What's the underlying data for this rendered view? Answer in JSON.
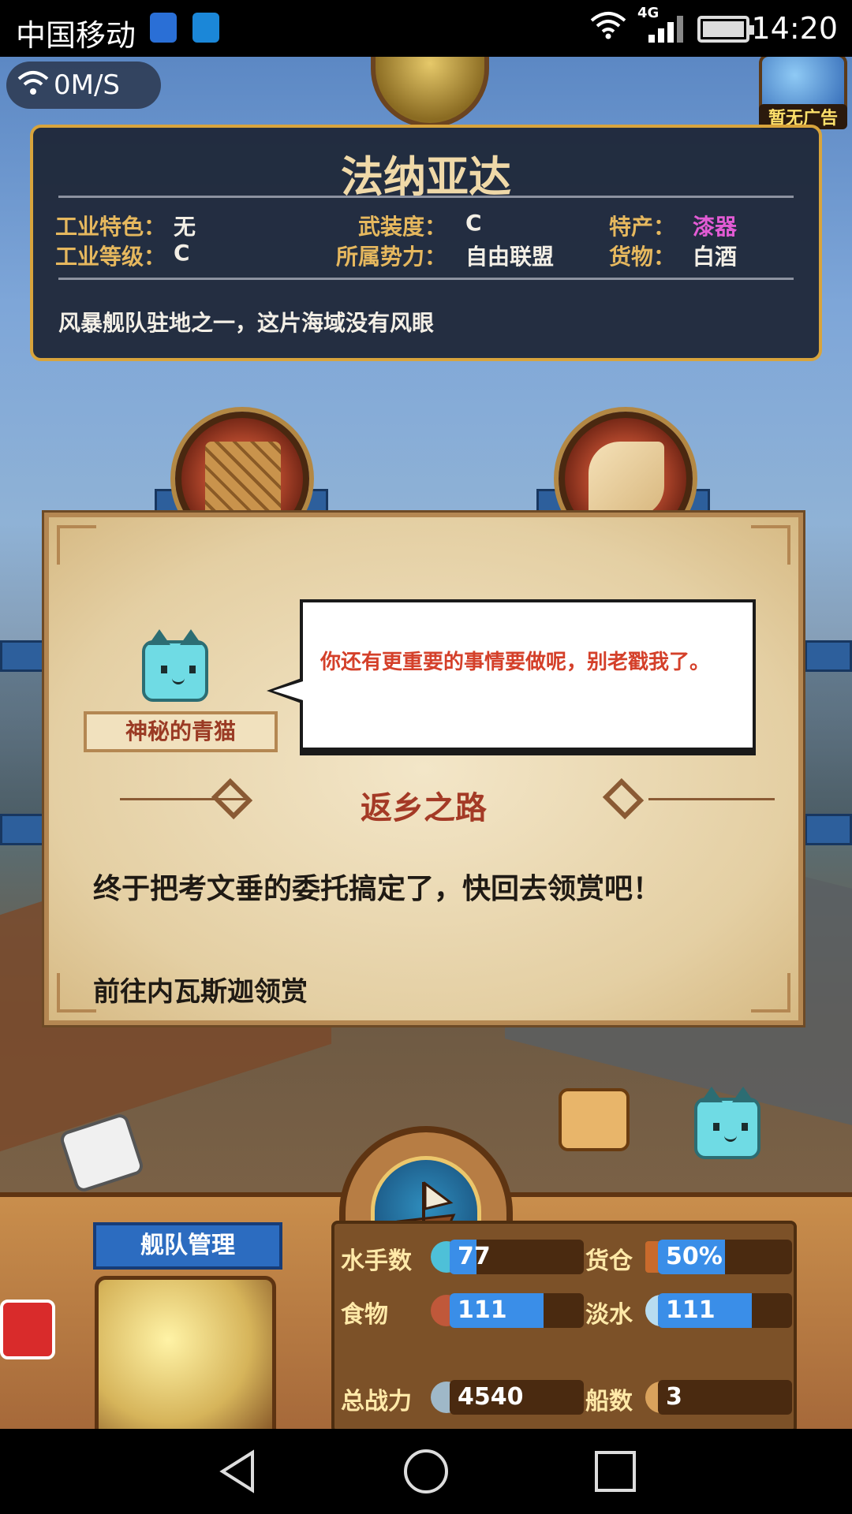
{
  "status_bar": {
    "carrier": "中国移动",
    "network": "4G",
    "time": "14:20"
  },
  "hud": {
    "net_speed": "0M/S",
    "ad_label": "暂无广告"
  },
  "port_info": {
    "name": "法纳亚达",
    "fields": [
      {
        "label": "工业特色：",
        "value": "无"
      },
      {
        "label": "工业等级：",
        "value": "C"
      },
      {
        "label": "武装度：",
        "value": "C"
      },
      {
        "label": "所属势力：",
        "value": "自由联盟"
      },
      {
        "label": "特产：",
        "value": "漆器"
      },
      {
        "label": "货物：",
        "value": "白酒"
      }
    ],
    "description": "风暴舰队驻地之一，这片海域没有风眼",
    "specialty_color": "#e25bd4"
  },
  "dialog": {
    "speaker_name": "神秘的青猫",
    "speech": "你还有更重要的事情要做呢，别老戳我了。",
    "quest_title": "返乡之路",
    "quest_text": "终于把考文垂的委托搞定了，快回去领赏吧！",
    "quest_goal": "前往内瓦斯迦领赏"
  },
  "fleet_panel": {
    "title": "舰队管理",
    "stats": [
      {
        "label": "水手数",
        "icon": "sailor-icon",
        "value": "77",
        "fill": 0.2
      },
      {
        "label": "货仓",
        "icon": "cargo-icon",
        "value": "50%",
        "fill": 0.5
      },
      {
        "label": "食物",
        "icon": "meat-icon",
        "value": "111",
        "fill": 0.7
      },
      {
        "label": "淡水",
        "icon": "water-icon",
        "value": "111",
        "fill": 0.7
      },
      {
        "label": "总战力",
        "icon": "swords-icon",
        "value": "4540",
        "fill": 0.0
      },
      {
        "label": "船数",
        "icon": "ship-icon",
        "value": "3",
        "fill": 0.0
      }
    ]
  },
  "colors": {
    "label_gold": "#e6b85e",
    "dialog_red": "#d4402a",
    "bar_blue": "#3a8ee8"
  }
}
